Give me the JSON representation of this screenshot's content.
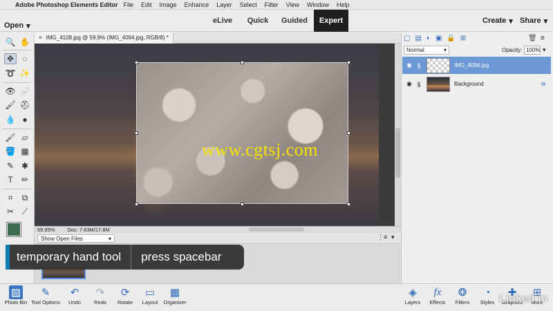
{
  "menubar": {
    "app_name": "Adobe Photoshop Elements Editor",
    "items": [
      "File",
      "Edit",
      "Image",
      "Enhance",
      "Layer",
      "Select",
      "Filter",
      "View",
      "Window",
      "Help"
    ]
  },
  "modebar": {
    "open_label": "Open",
    "tabs": [
      "eLive",
      "Quick",
      "Guided",
      "Expert"
    ],
    "active_tab": "Expert",
    "create_label": "Create",
    "share_label": "Share"
  },
  "document": {
    "tab_title": "IMG_4108.jpg @ 59.9% (IMG_4094.jpg, RGB/8) *",
    "zoom": "59.95%",
    "doc_info": "Doc: 7.63M/17.8M",
    "watermark": "www.cgtsj.com"
  },
  "photo_bin": {
    "select_label": "Show Open Files"
  },
  "caption": {
    "part1": "temporary hand tool",
    "part2": "press spacebar"
  },
  "layers_panel": {
    "blend_mode": "Normal",
    "opacity_label": "Opacity:",
    "opacity_value": "100%",
    "layers": [
      "IMG_4094.jpg",
      "Background"
    ]
  },
  "bottom": {
    "left": [
      "Photo Bin",
      "Tool Options",
      "Undo",
      "Redo",
      "Rotate",
      "Layout",
      "Organizer"
    ],
    "right": [
      "Layers",
      "Effects",
      "Filters",
      "Styles",
      "Graphics",
      "More"
    ]
  },
  "brand_watermark": "Linked in",
  "colors": {
    "accent": "#0e7bb5",
    "selection": "#6c99d6",
    "foreground_swatch": "#3d6b4f"
  }
}
